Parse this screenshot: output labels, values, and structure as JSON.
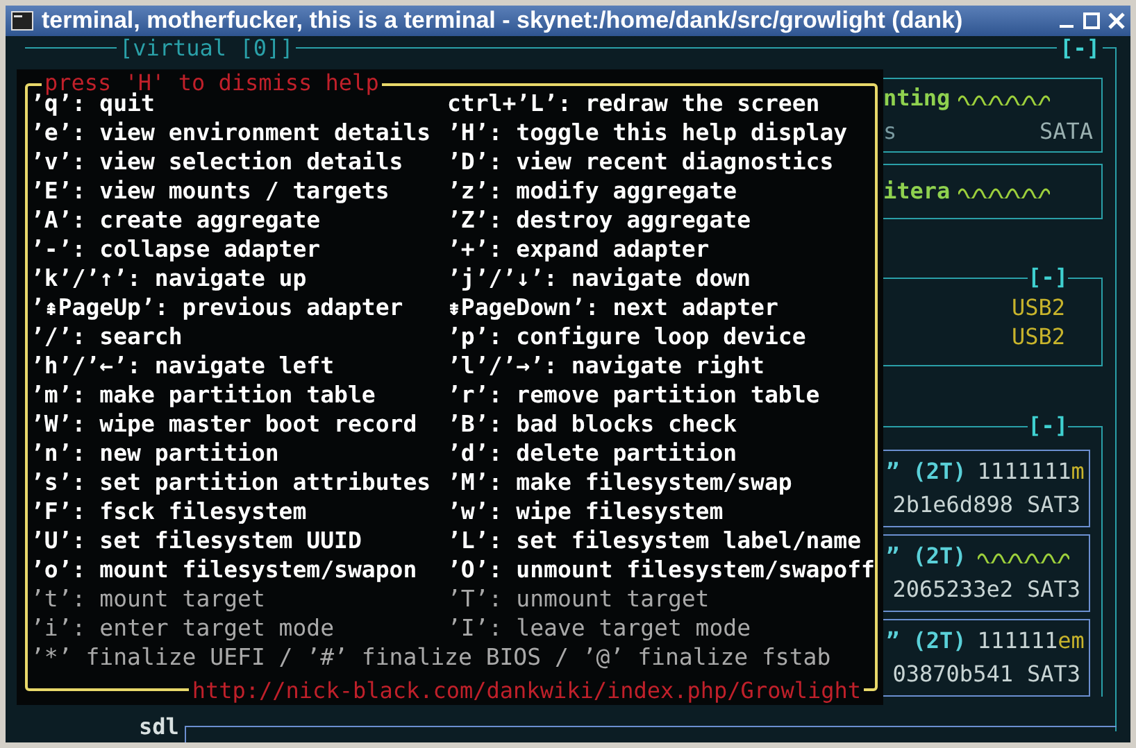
{
  "window": {
    "title": "terminal, motherfucker, this is a terminal - skynet:/home/dank/src/growlight (dank)"
  },
  "frame": {
    "label": "[virtual [0]]",
    "toggle": "[-]"
  },
  "adapters": [
    {
      "name": "nting",
      "sub": "s",
      "bus": "SATA"
    },
    {
      "name": "itera"
    }
  ],
  "usb_group": {
    "toggle": "[-]",
    "lines": [
      "USB2",
      "USB2"
    ]
  },
  "disk_group": {
    "toggle": "[-]",
    "disks": [
      {
        "size": "” (2T)",
        "serial": "1111111",
        "serial_tail": "m",
        "id": "2b1e6d898",
        "bus": "SAT3"
      },
      {
        "size": "” (2T)",
        "id": "2065233e2",
        "bus": "SAT3"
      },
      {
        "size": "” (2T)",
        "serial": "111111",
        "serial_tail": "em",
        "id": "03870b541",
        "bus": "SAT3"
      }
    ]
  },
  "bottom_adapter": {
    "name": "sdl"
  },
  "help": {
    "title": "press 'H' to dismiss help",
    "rows": [
      {
        "left": "’q’: quit",
        "right": "ctrl+’L’: redraw the screen",
        "disabled": false
      },
      {
        "left": "’e’: view environment details",
        "right": "’H’: toggle this help display",
        "disabled": false
      },
      {
        "left": "’v’: view selection details",
        "right": "’D’: view recent diagnostics",
        "disabled": false
      },
      {
        "left": "’E’: view mounts / targets",
        "right": "’z’: modify aggregate",
        "disabled": false
      },
      {
        "left": "’A’: create aggregate",
        "right": "’Z’: destroy aggregate",
        "disabled": false
      },
      {
        "left": "’-’: collapse adapter",
        "right": "’+’: expand adapter",
        "disabled": false
      },
      {
        "left": "’k’/’↑’: navigate up",
        "right": "’j’/’↓’: navigate down",
        "disabled": false
      },
      {
        "left": "’⇞PageUp’: previous adapter",
        "right": "⇟PageDown’: next adapter",
        "disabled": false
      },
      {
        "left": "’/’: search",
        "right": "’p’: configure loop device",
        "disabled": false
      },
      {
        "left": "’h’/’←’: navigate left",
        "right": "’l’/’→’: navigate right",
        "disabled": false
      },
      {
        "left": "’m’: make partition table",
        "right": "’r’: remove partition table",
        "disabled": false
      },
      {
        "left": "’W’: wipe master boot record",
        "right": "’B’: bad blocks check",
        "disabled": false
      },
      {
        "left": "’n’: new partition",
        "right": "’d’: delete partition",
        "disabled": false
      },
      {
        "left": "’s’: set partition attributes",
        "right": "’M’: make filesystem/swap",
        "disabled": false
      },
      {
        "left": "’F’: fsck filesystem",
        "right": "’w’: wipe filesystem",
        "disabled": false
      },
      {
        "left": "’U’: set filesystem UUID",
        "right": "’L’: set filesystem label/name",
        "disabled": false
      },
      {
        "left": "’o’: mount filesystem/swapon",
        "right": "’O’: unmount filesystem/swapoff",
        "disabled": false
      },
      {
        "left": "’t’: mount target",
        "right": "’T’: unmount target",
        "disabled": true
      },
      {
        "left": "’i’: enter target mode",
        "right": "’I’: leave target mode",
        "disabled": true
      }
    ],
    "footer": {
      "text": "’*’ finalize UEFI / ’#’ finalize BIOS / ’@’ finalize fstab",
      "disabled": true
    },
    "link": "http://nick-black.com/dankwiki/index.php/Growlight"
  }
}
